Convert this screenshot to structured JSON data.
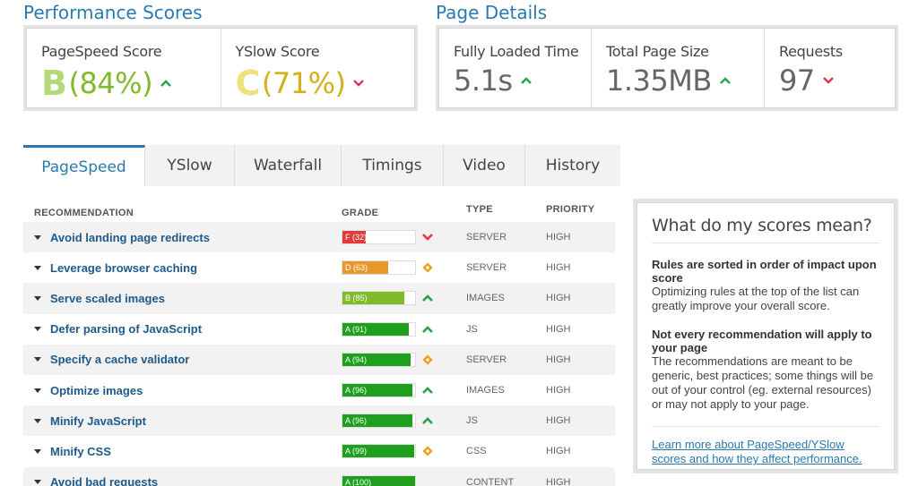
{
  "performance": {
    "title": "Performance Scores",
    "pagespeed": {
      "label": "PageSpeed Score",
      "grade": "B",
      "value": "(84%)"
    },
    "yslow": {
      "label": "YSlow Score",
      "grade": "C",
      "value": "(71%)"
    }
  },
  "details": {
    "title": "Page Details",
    "load_time": {
      "label": "Fully Loaded Time",
      "value": "5.1s"
    },
    "page_size": {
      "label": "Total Page Size",
      "value": "1.35MB"
    },
    "requests": {
      "label": "Requests",
      "value": "97"
    }
  },
  "tabs": [
    "PageSpeed",
    "YSlow",
    "Waterfall",
    "Timings",
    "Video",
    "History"
  ],
  "table": {
    "headers": {
      "recommendation": "RECOMMENDATION",
      "grade": "GRADE",
      "type": "TYPE",
      "priority": "PRIORITY"
    },
    "rows": [
      {
        "name": "Avoid landing page redirects",
        "grade": "F (32)",
        "score": 32,
        "color": "#e03a3a",
        "type": "SERVER",
        "priority": "HIGH",
        "trend": "down"
      },
      {
        "name": "Leverage browser caching",
        "grade": "D (63)",
        "score": 63,
        "color": "#e8982a",
        "type": "SERVER",
        "priority": "HIGH",
        "trend": "neutral"
      },
      {
        "name": "Serve scaled images",
        "grade": "B (85)",
        "score": 85,
        "color": "#7fba2a",
        "type": "IMAGES",
        "priority": "HIGH",
        "trend": "up"
      },
      {
        "name": "Defer parsing of JavaScript",
        "grade": "A (91)",
        "score": 91,
        "color": "#1ea01e",
        "type": "JS",
        "priority": "HIGH",
        "trend": "up"
      },
      {
        "name": "Specify a cache validator",
        "grade": "A (94)",
        "score": 94,
        "color": "#1ea01e",
        "type": "SERVER",
        "priority": "HIGH",
        "trend": "neutral"
      },
      {
        "name": "Optimize images",
        "grade": "A (96)",
        "score": 96,
        "color": "#1ea01e",
        "type": "IMAGES",
        "priority": "HIGH",
        "trend": "up"
      },
      {
        "name": "Minify JavaScript",
        "grade": "A (96)",
        "score": 96,
        "color": "#1ea01e",
        "type": "JS",
        "priority": "HIGH",
        "trend": "up"
      },
      {
        "name": "Minify CSS",
        "grade": "A (99)",
        "score": 99,
        "color": "#1ea01e",
        "type": "CSS",
        "priority": "HIGH",
        "trend": "neutral"
      },
      {
        "name": "Avoid bad requests",
        "grade": "A (100)",
        "score": 100,
        "color": "#1ea01e",
        "type": "CONTENT",
        "priority": "HIGH",
        "trend": "none"
      }
    ]
  },
  "info": {
    "title": "What do my scores mean?",
    "h1": "Rules are sorted in order of impact upon score",
    "p1": "Optimizing rules at the top of the list can greatly improve your overall score.",
    "h2": "Not every recommendation will apply to your page",
    "p2": "The recommendations are meant to be generic, best practices; some things will be out of your control (eg. external resources) or may not apply to your page.",
    "link": "Learn more about PageSpeed/YSlow scores and how they affect performance."
  },
  "colors": {
    "accent": "#2a7ab0",
    "up": "#2aa14a",
    "down": "#e0384e",
    "neutral": "#f0a020"
  }
}
